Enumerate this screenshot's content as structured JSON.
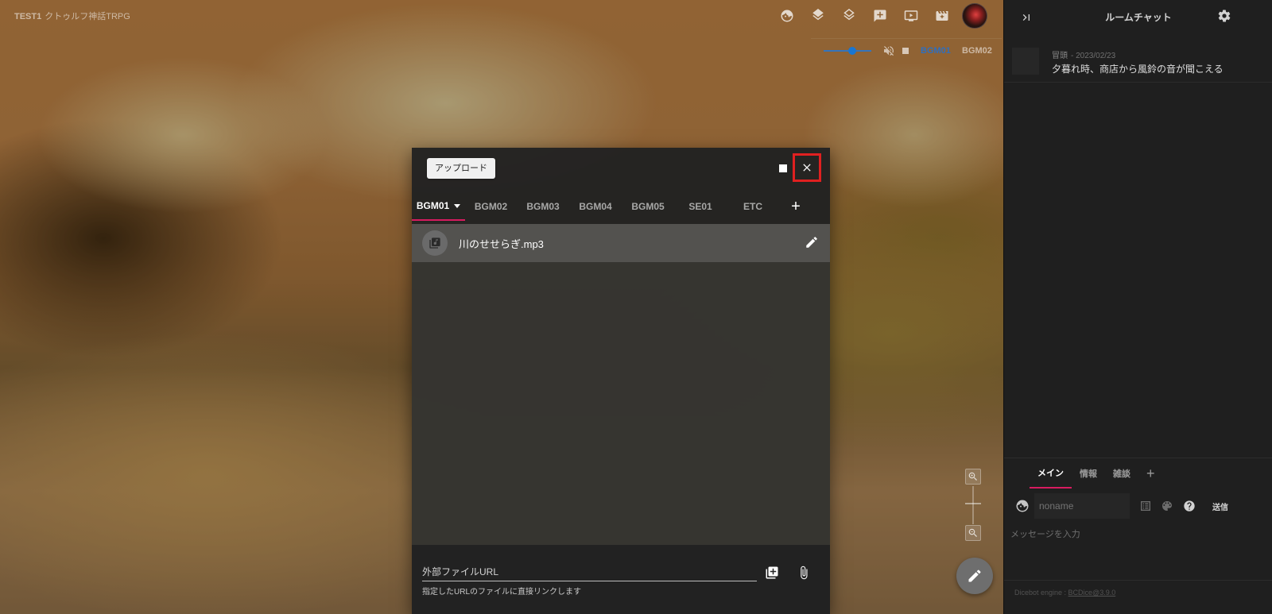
{
  "app": {
    "room_name": "TEST1",
    "game_system": "クトゥルフ神話TRPG"
  },
  "toolbar": {
    "icons": [
      "face-icon",
      "layers-icon",
      "layers-outline-icon",
      "add-comment-icon",
      "screen-icon",
      "clapperboard-icon"
    ]
  },
  "audio": {
    "volume_fraction": 0.6,
    "channels": [
      "BGM01",
      "BGM02"
    ],
    "active_channel": "BGM01"
  },
  "dialog": {
    "upload_label": "アップロード",
    "tabs": [
      "BGM01",
      "BGM02",
      "BGM03",
      "BGM04",
      "BGM05",
      "SE01",
      "ETC"
    ],
    "active_tab": "BGM01",
    "add_tab_label": "+",
    "tracks": [
      {
        "name": "川のせせらぎ.mp3"
      }
    ],
    "url_label": "外部ファイルURL",
    "url_hint": "指定したURLのファイルに直接リンクします"
  },
  "chat": {
    "title": "ルームチャット",
    "messages": [
      {
        "name": "冒頭",
        "date": "- 2023/02/23",
        "text": "夕暮れ時、商店から風鈴の音が聞こえる"
      }
    ],
    "tabs": [
      "メイン",
      "情報",
      "雑談"
    ],
    "active_tab": "メイン",
    "add_tab_label": "+",
    "name_placeholder": "noname",
    "send_label": "送信",
    "message_placeholder": "メッセージを入力",
    "footer_prefix": "Dicebot engine : ",
    "footer_link": "BCDice@3.9.0"
  },
  "colors": {
    "accent": "#d81b60",
    "active_channel": "#2f6fbf",
    "close_highlight": "#e02020"
  }
}
